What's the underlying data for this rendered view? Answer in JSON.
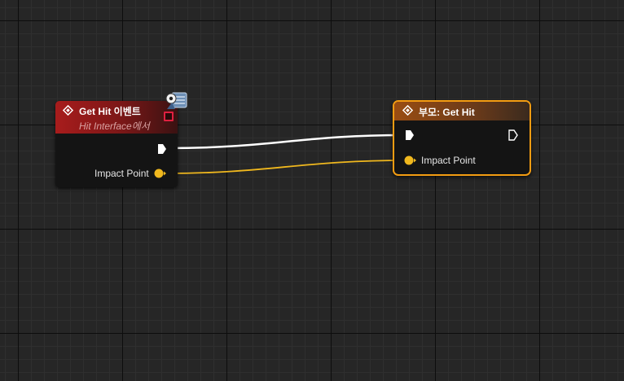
{
  "graph": {
    "wire_colors": {
      "exec": "#ffffff",
      "vector": "#f0b81e"
    }
  },
  "event_node": {
    "title": "Get Hit 이벤트",
    "subtitle": "Hit Interface에서",
    "header_color": "#a81c1c",
    "icon": "event-diamond-icon",
    "pins": {
      "impact_point_label": "Impact Point"
    }
  },
  "parent_node": {
    "title": "부모: Get Hit",
    "header_color": "#9a4d12",
    "selection_color": "#f39c12",
    "icon": "function-diamond-icon",
    "pins": {
      "impact_point_label": "Impact Point"
    }
  }
}
